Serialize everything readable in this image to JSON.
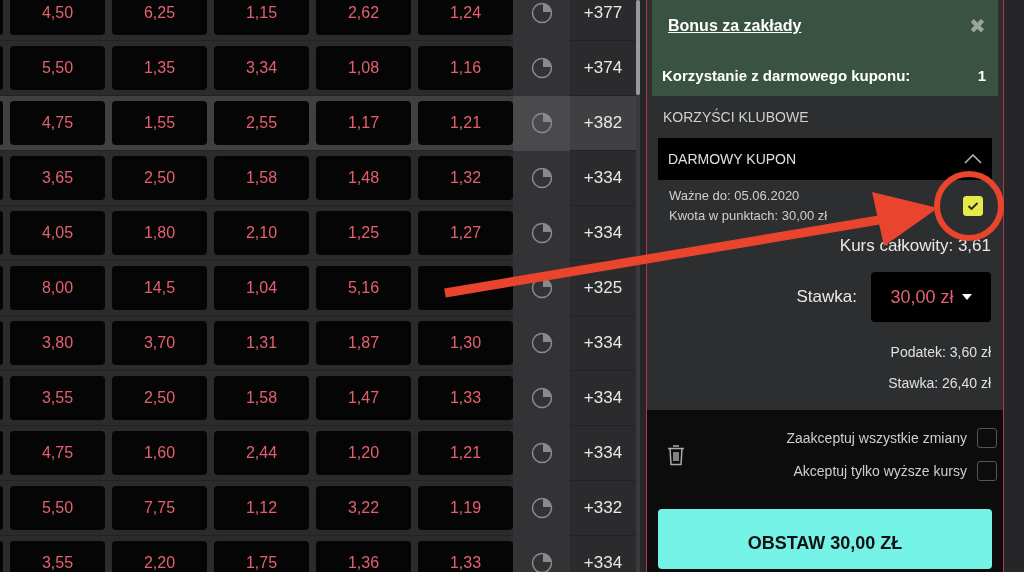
{
  "odds_table": {
    "rows": [
      {
        "odds": [
          "4,50",
          "6,25",
          "1,15",
          "2,62",
          "1,24"
        ],
        "more": "+377",
        "highlighted": false
      },
      {
        "odds": [
          "5,50",
          "1,35",
          "3,34",
          "1,08",
          "1,16"
        ],
        "more": "+374",
        "highlighted": false
      },
      {
        "odds": [
          "4,75",
          "1,55",
          "2,55",
          "1,17",
          "1,21"
        ],
        "more": "+382",
        "highlighted": true
      },
      {
        "odds": [
          "3,65",
          "2,50",
          "1,58",
          "1,48",
          "1,32"
        ],
        "more": "+334",
        "highlighted": false
      },
      {
        "odds": [
          "4,05",
          "1,80",
          "2,10",
          "1,25",
          "1,27"
        ],
        "more": "+334",
        "highlighted": false
      },
      {
        "odds": [
          "8,00",
          "14,5",
          "1,04",
          "5,16"
        ],
        "more": "+325",
        "highlighted": false
      },
      {
        "odds": [
          "3,80",
          "3,70",
          "1,31",
          "1,87",
          "1,30"
        ],
        "more": "+334",
        "highlighted": false
      },
      {
        "odds": [
          "3,55",
          "2,50",
          "1,58",
          "1,47",
          "1,33"
        ],
        "more": "+334",
        "highlighted": false
      },
      {
        "odds": [
          "4,75",
          "1,60",
          "2,44",
          "1,20",
          "1,21"
        ],
        "more": "+334",
        "highlighted": false
      },
      {
        "odds": [
          "5,50",
          "7,75",
          "1,12",
          "3,22",
          "1,19"
        ],
        "more": "+332",
        "highlighted": false
      },
      {
        "odds": [
          "3,55",
          "2,20",
          "1,75",
          "1,36",
          "1,33"
        ],
        "more": "+334",
        "highlighted": false
      }
    ]
  },
  "bet_slip": {
    "bonus": {
      "title": "Bonus za zakłady",
      "close": "✖",
      "label": "Korzystanie z darmowego kuponu:",
      "count": "1"
    },
    "section_title": "KORZYŚCI KLUBOWE",
    "coupon": {
      "title": "DARMOWY KUPON",
      "expanded": true,
      "valid_until": "Ważne do: 05.06.2020",
      "points_amount": "Kwota w punktach: 30,00 zł",
      "checked": true
    },
    "total_odds": "Kurs całkowity: 3,61",
    "stake": {
      "label": "Stawka:",
      "value": "30,00 zł"
    },
    "tax": "Podatek: 3,60 zł",
    "net_stake": "Stawka: 26,40 zł",
    "options": [
      {
        "label": "Zaakceptuj wszystkie zmiany",
        "checked": false
      },
      {
        "label": "Akceptuj tylko wyższe kursy",
        "checked": false
      }
    ],
    "submit": "OBSTAW 30,00 ZŁ"
  },
  "annotations": {
    "arrow": true,
    "circle": true
  }
}
